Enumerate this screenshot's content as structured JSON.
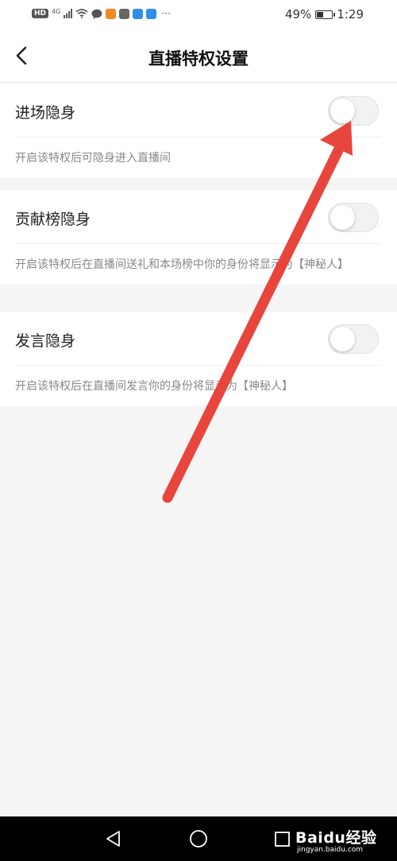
{
  "status_bar": {
    "network_badge": "HD",
    "network_type": "4G",
    "overflow_dots": "···",
    "battery_text": "49%",
    "battery_level": 0.49,
    "time": "1:29"
  },
  "header": {
    "title": "直播特权设置"
  },
  "settings": [
    {
      "label": "进场隐身",
      "enabled": false,
      "description": "开启该特权后可隐身进入直播间"
    },
    {
      "label": "贡献榜隐身",
      "enabled": false,
      "description": "开启该特权后在直播间送礼和本场榜中你的身份将显示为【神秘人】"
    },
    {
      "label": "发言隐身",
      "enabled": false,
      "description": "开启该特权后在直播间发言你的身份将显示为【神秘人】"
    }
  ],
  "watermark": {
    "brand": "Baidu经验",
    "url": "jingyan.baidu.com"
  },
  "colors": {
    "annotation_arrow": "#e8453c",
    "page_background": "#f5f5f5",
    "toggle_off": "#f2f2f2"
  }
}
